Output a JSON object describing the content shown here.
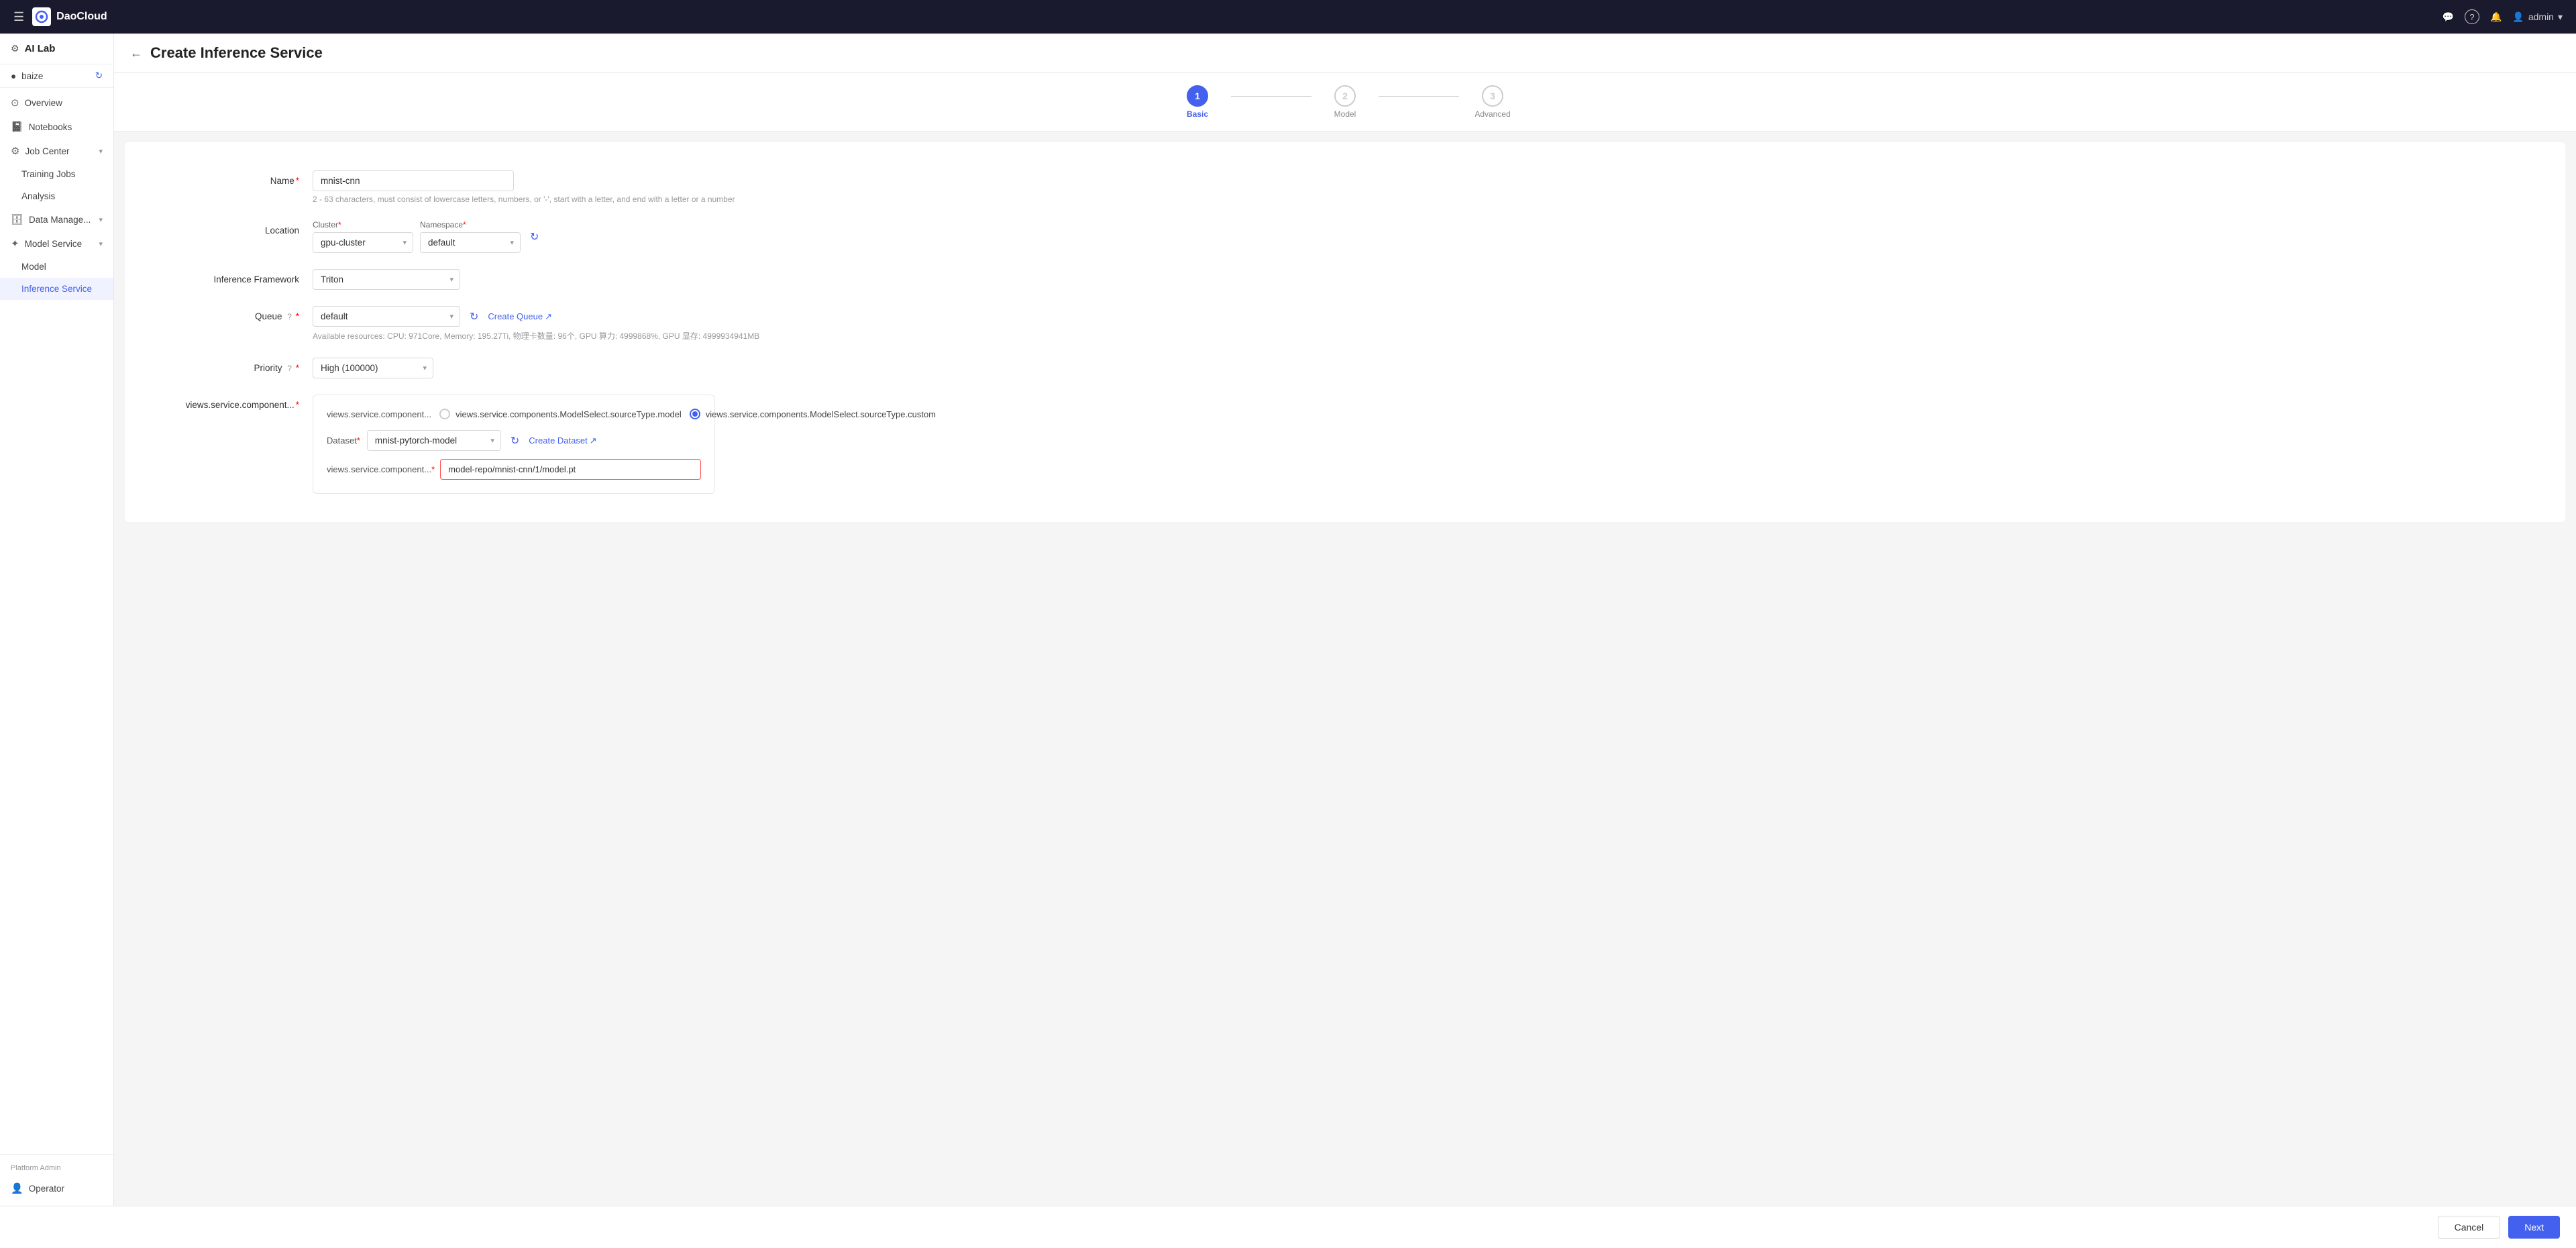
{
  "topnav": {
    "hamburger_icon": "☰",
    "logo_text": "DaoCloud",
    "message_icon": "💬",
    "help_icon": "?",
    "bell_icon": "🔔",
    "user_icon": "👤",
    "admin_label": "admin",
    "dropdown_icon": "▾"
  },
  "sidebar": {
    "header_icon": "⚙",
    "header_title": "AI Lab",
    "workspace_label": "baize",
    "refresh_icon": "↻",
    "items": [
      {
        "id": "overview",
        "label": "Overview",
        "icon": "⊙",
        "active": false
      },
      {
        "id": "notebooks",
        "label": "Notebooks",
        "icon": "📓",
        "active": false
      },
      {
        "id": "job-center",
        "label": "Job Center",
        "icon": "⚙",
        "active": false,
        "arrow": "▾"
      },
      {
        "id": "training-jobs",
        "label": "Training Jobs",
        "sub": true,
        "active": false
      },
      {
        "id": "analysis",
        "label": "Analysis",
        "sub": true,
        "active": false
      },
      {
        "id": "data-manage",
        "label": "Data Manage...",
        "icon": "🗄",
        "active": false,
        "arrow": "▾"
      },
      {
        "id": "model-service",
        "label": "Model Service",
        "icon": "✦",
        "active": false,
        "arrow": "▾"
      },
      {
        "id": "model",
        "label": "Model",
        "sub": true,
        "active": false
      },
      {
        "id": "inference-service",
        "label": "Inference Service",
        "sub": true,
        "active": true
      }
    ],
    "bottom_label": "Platform Admin",
    "operator_label": "Operator",
    "operator_icon": "👤"
  },
  "page": {
    "back_icon": "←",
    "title": "Create Inference Service"
  },
  "steps": [
    {
      "number": "1",
      "label": "Basic",
      "state": "active"
    },
    {
      "number": "2",
      "label": "Model",
      "state": "inactive"
    },
    {
      "number": "3",
      "label": "Advanced",
      "state": "inactive"
    }
  ],
  "form": {
    "name_label": "Name",
    "name_value": "mnist-cnn",
    "name_hint": "2 - 63 characters, must consist of lowercase letters, numbers, or '-', start with a letter, and end with a letter or a number",
    "location_label": "Location",
    "cluster_label": "Cluster",
    "cluster_value": "gpu-cluster",
    "namespace_label": "Namespace",
    "namespace_value": "default",
    "refresh_icon": "↻",
    "inference_framework_label": "Inference Framework",
    "inference_framework_value": "Triton",
    "queue_label": "Queue",
    "queue_value": "default",
    "create_queue_label": "Create Queue",
    "external_link_icon": "↗",
    "resources_hint": "Available resources: CPU: 971Core, Memory: 195.27Ti, 物理卡数量: 96个, GPU 算力: 4999868%, GPU 显存: 4999934941MB",
    "priority_label": "Priority",
    "priority_value": "High (100000)",
    "source_type_label": "views.service.component...",
    "source_outer_label": "views.service.component...",
    "option1_label": "views.service.components.ModelSelect.sourceType.model",
    "option2_label": "views.service.components.ModelSelect.sourceType.custom",
    "option2_checked": true,
    "dataset_label": "Dataset",
    "dataset_value": "mnist-pytorch-model",
    "create_dataset_label": "Create Dataset",
    "path_label": "views.service.component...",
    "path_value": "model-repo/mnist-cnn/1/model.pt"
  },
  "footer": {
    "cancel_label": "Cancel",
    "next_label": "Next"
  }
}
